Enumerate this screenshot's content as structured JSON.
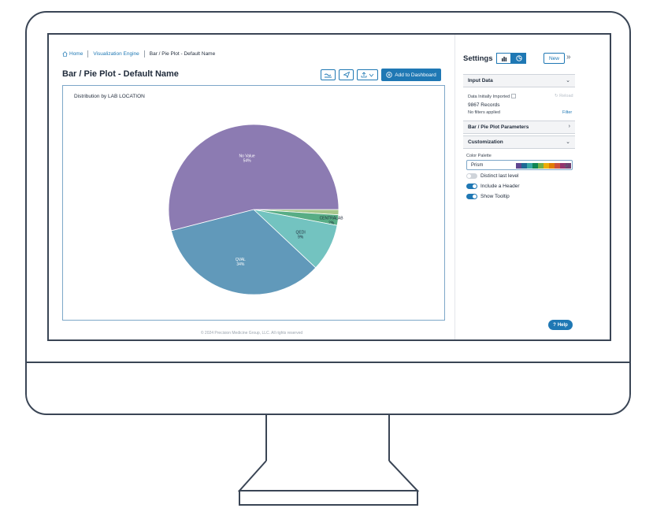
{
  "breadcrumb": {
    "home": "Home",
    "engine": "Visualization Engine",
    "current": "Bar / Pie Plot - Default Name"
  },
  "page_title": "Bar / Pie Plot - Default Name",
  "toolbar": {
    "add_label": "Add to Dashboard"
  },
  "chart_title": "Distribution by LAB LOCATION",
  "chart_data": {
    "type": "pie",
    "title": "Distribution by LAB LOCATION",
    "slices": [
      {
        "label": "No Value",
        "pct_label": "54%",
        "value": 54,
        "color": "#8c7bb2"
      },
      {
        "label": "QVAL",
        "pct_label": "34%",
        "value": 34,
        "color": "#6199ba"
      },
      {
        "label": "QEDI",
        "pct_label": "9%",
        "value": 9,
        "color": "#73c3c0"
      },
      {
        "label": "CENTRALAB",
        "pct_label": "2%",
        "value": 2,
        "color": "#58ad85"
      },
      {
        "label": "",
        "pct_label": "",
        "value": 1,
        "color": "#a7c78c"
      }
    ]
  },
  "footer": "© 2024 Precision Medicine Group, LLC. All rights reserved",
  "settings": {
    "title": "Settings",
    "new_label": "New",
    "input_data": {
      "header": "Input Data",
      "imported_label": "Data Initially Imported",
      "reload_label": "Reload",
      "records": "9867 Records",
      "filters": "No filters applied",
      "filter_link": "Filter"
    },
    "parameters_header": "Bar / Pie Plot Parameters",
    "customization": {
      "header": "Customization",
      "palette_label": "Color Palette",
      "palette_value": "Prism",
      "palette_colors": [
        "#5f4690",
        "#1d6996",
        "#38a6a5",
        "#0f8554",
        "#73af48",
        "#edad08",
        "#e17c05",
        "#cc503e",
        "#94346e",
        "#6f4070"
      ],
      "toggles": [
        {
          "label": "Distinct last level",
          "on": false
        },
        {
          "label": "Include a Header",
          "on": true
        },
        {
          "label": "Show Tooltip",
          "on": true
        }
      ]
    },
    "help_label": "Help"
  }
}
